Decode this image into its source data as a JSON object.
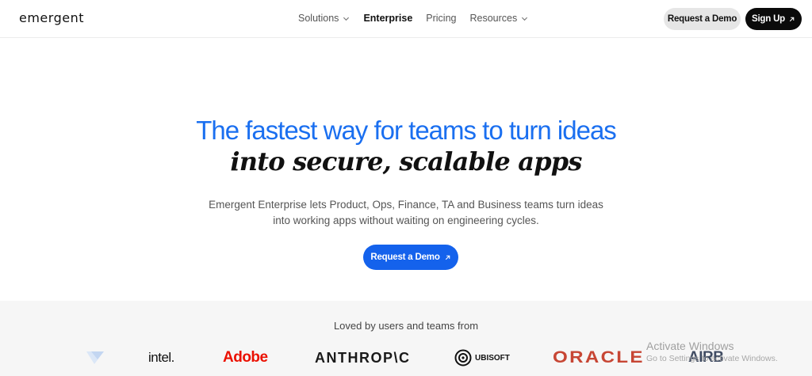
{
  "nav": {
    "logo": "emergent",
    "links": [
      {
        "label": "Solutions",
        "has_dropdown": true
      },
      {
        "label": "Enterprise",
        "active": true
      },
      {
        "label": "Pricing"
      },
      {
        "label": "Resources",
        "has_dropdown": true
      }
    ],
    "request_demo_label": "Request a Demo",
    "signup_label": "Sign Up"
  },
  "hero": {
    "title": "The fastest way for teams to turn ideas",
    "subtitle": "into secure, scalable apps",
    "description": "Emergent Enterprise lets Product, Ops, Finance, TA and Business teams turn ideas into working apps without waiting on engineering cycles.",
    "cta_label": "Request a Demo"
  },
  "logos": {
    "title": "Loved by users and teams from",
    "items": [
      "intel.",
      "Adobe",
      "ANTHROP\\C",
      "UBISOFT",
      "ORACLE",
      "AIRB"
    ]
  },
  "watermark": {
    "line1": "Activate Windows",
    "line2": "Go to Settings to activate Windows."
  },
  "colors": {
    "accent_blue": "#1a6ff0",
    "cta_blue": "#1462ec",
    "adobe_red": "#eb1000",
    "oracle_red": "#c74634"
  }
}
